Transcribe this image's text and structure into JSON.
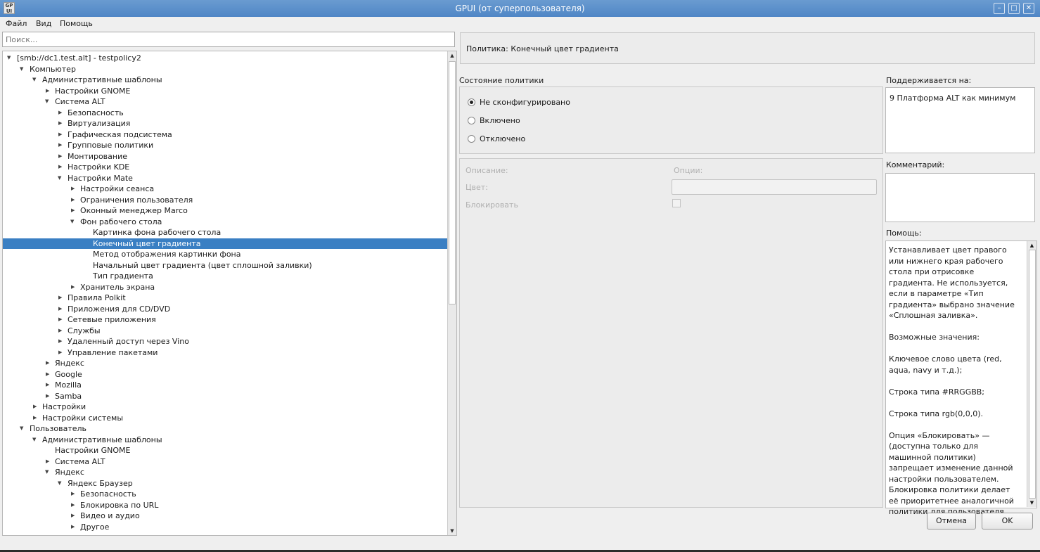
{
  "window": {
    "title": "GPUI (от суперпользователя)",
    "icon_text": "GP UI",
    "buttons": [
      "minimize-icon",
      "maximize-icon",
      "close-icon"
    ]
  },
  "menu": [
    "Файл",
    "Вид",
    "Помощь"
  ],
  "search": {
    "placeholder": "Поиск...",
    "value": ""
  },
  "tree": [
    {
      "label": "[smb://dc1.test.alt] - testpolicy2",
      "depth": 0,
      "arrow": "▼"
    },
    {
      "label": "Компьютер",
      "depth": 1,
      "arrow": "▼"
    },
    {
      "label": "Административные шаблоны",
      "depth": 2,
      "arrow": "▼"
    },
    {
      "label": "Настройки GNOME",
      "depth": 3,
      "arrow": "▶"
    },
    {
      "label": "Система ALT",
      "depth": 3,
      "arrow": "▼"
    },
    {
      "label": "Безопасность",
      "depth": 4,
      "arrow": "▶"
    },
    {
      "label": "Виртуализация",
      "depth": 4,
      "arrow": "▶"
    },
    {
      "label": "Графическая подсистема",
      "depth": 4,
      "arrow": "▶"
    },
    {
      "label": "Групповые политики",
      "depth": 4,
      "arrow": "▶"
    },
    {
      "label": "Монтирование",
      "depth": 4,
      "arrow": "▶"
    },
    {
      "label": "Настройки KDE",
      "depth": 4,
      "arrow": "▶"
    },
    {
      "label": "Настройки Mate",
      "depth": 4,
      "arrow": "▼"
    },
    {
      "label": "Настройки сеанса",
      "depth": 5,
      "arrow": "▶"
    },
    {
      "label": "Ограничения пользователя",
      "depth": 5,
      "arrow": "▶"
    },
    {
      "label": "Оконный менеджер Marco",
      "depth": 5,
      "arrow": "▶"
    },
    {
      "label": "Фон рабочего стола",
      "depth": 5,
      "arrow": "▼"
    },
    {
      "label": "Картинка фона рабочего стола",
      "depth": 6,
      "arrow": ""
    },
    {
      "label": "Конечный цвет градиента",
      "depth": 6,
      "arrow": "",
      "selected": true
    },
    {
      "label": "Метод отображения картинки фона",
      "depth": 6,
      "arrow": ""
    },
    {
      "label": "Начальный цвет градиента (цвет сплошной заливки)",
      "depth": 6,
      "arrow": ""
    },
    {
      "label": "Тип градиента",
      "depth": 6,
      "arrow": ""
    },
    {
      "label": "Хранитель экрана",
      "depth": 5,
      "arrow": "▶"
    },
    {
      "label": "Правила Polkit",
      "depth": 4,
      "arrow": "▶"
    },
    {
      "label": "Приложения для CD/DVD",
      "depth": 4,
      "arrow": "▶"
    },
    {
      "label": "Сетевые приложения",
      "depth": 4,
      "arrow": "▶"
    },
    {
      "label": "Службы",
      "depth": 4,
      "arrow": "▶"
    },
    {
      "label": "Удаленный доступ через Vino",
      "depth": 4,
      "arrow": "▶"
    },
    {
      "label": "Управление пакетами",
      "depth": 4,
      "arrow": "▶"
    },
    {
      "label": "Яндекс",
      "depth": 3,
      "arrow": "▶"
    },
    {
      "label": "Google",
      "depth": 3,
      "arrow": "▶"
    },
    {
      "label": "Mozilla",
      "depth": 3,
      "arrow": "▶"
    },
    {
      "label": "Samba",
      "depth": 3,
      "arrow": "▶"
    },
    {
      "label": "Настройки",
      "depth": 2,
      "arrow": "▶"
    },
    {
      "label": "Настройки системы",
      "depth": 2,
      "arrow": "▶"
    },
    {
      "label": "Пользователь",
      "depth": 1,
      "arrow": "▼"
    },
    {
      "label": "Административные шаблоны",
      "depth": 2,
      "arrow": "▼"
    },
    {
      "label": "Настройки GNOME",
      "depth": 3,
      "arrow": ""
    },
    {
      "label": "Система ALT",
      "depth": 3,
      "arrow": "▶"
    },
    {
      "label": "Яндекс",
      "depth": 3,
      "arrow": "▼"
    },
    {
      "label": "Яндекс Браузер",
      "depth": 4,
      "arrow": "▼"
    },
    {
      "label": "Безопасность",
      "depth": 5,
      "arrow": "▶"
    },
    {
      "label": "Блокировка по URL",
      "depth": 5,
      "arrow": "▶"
    },
    {
      "label": "Видео и аудио",
      "depth": 5,
      "arrow": "▶"
    },
    {
      "label": "Другое",
      "depth": 5,
      "arrow": "▶"
    }
  ],
  "policy": {
    "header": "Политика: Конечный цвет градиента",
    "state_label": "Состояние политики",
    "states": [
      {
        "label": "Не сконфигурировано",
        "checked": true
      },
      {
        "label": "Включено",
        "checked": false
      },
      {
        "label": "Отключено",
        "checked": false
      }
    ],
    "description_label": "Описание:",
    "options_label": "Опции:",
    "color_label": "Цвет:",
    "color_value": "",
    "lock_label": "Блокировать",
    "lock_checked": false
  },
  "supported": {
    "label": "Поддерживается на:",
    "value": "9 Платформа ALT как минимум"
  },
  "comment": {
    "label": "Комментарий:",
    "value": ""
  },
  "help": {
    "label": "Помощь:",
    "text": "Устанавливает цвет правого или нижнего края рабочего стола при отрисовке градиента. Не используется, если в параметре «Тип градиента» выбрано значение «Сплошная заливка».\n\nВозможные значения:\n\nКлючевое слово цвета (red, aqua, navy и т.д.);\n\nСтрока типа #RRGGBB;\n\nСтрока типа rgb(0,0,0).\n\nОпция «Блокировать» — (доступна только для машинной политики) запрещает изменение данной настройки пользователем. Блокировка политики делает её приоритетнее аналогичной политики для пользователя."
  },
  "buttons": {
    "cancel": "Отмена",
    "ok": "OK"
  },
  "colors": {
    "selection": "#3a7fc3",
    "titlebar": "#5a8fcb"
  }
}
